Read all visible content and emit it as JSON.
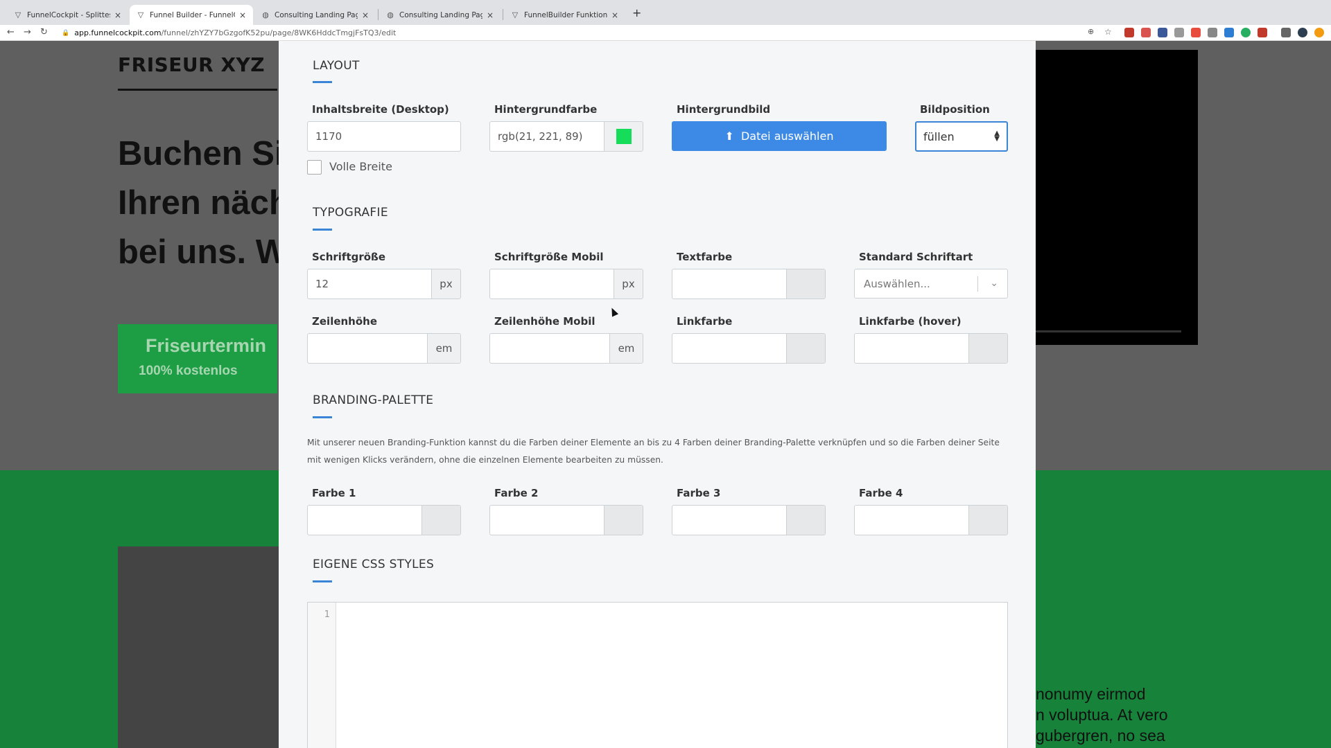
{
  "browser": {
    "tabs": [
      {
        "title": "FunnelCockpit - Splittests, Ma",
        "icon": "funnel-icon",
        "active": false
      },
      {
        "title": "Funnel Builder - FunnelCockpit",
        "icon": "funnel-icon",
        "active": true
      },
      {
        "title": "Consulting Landing Page",
        "icon": "globe-icon",
        "active": false
      },
      {
        "title": "Consulting Landing Page",
        "icon": "globe-icon",
        "active": false
      },
      {
        "title": "FunnelBuilder Funktionen & El",
        "icon": "funnel-icon",
        "active": false
      }
    ],
    "url_host": "app.funnelcockpit.com",
    "url_path": "/funnel/zhYZY7bGzgofK52pu/page/8WK6HddcTmgjFsTQ3/edit"
  },
  "background_page": {
    "brand": "FRISEUR XYZ",
    "hero_lines": [
      "Buchen Si",
      "Ihren näch",
      "bei uns. W"
    ],
    "cta_line1": "Friseurtermin",
    "cta_line2": "100% kostenlos",
    "lorem_lines": [
      "nonumy eirmod",
      "n voluptua. At vero",
      "gubergren, no sea"
    ]
  },
  "modal": {
    "layout": {
      "title": "LAYOUT",
      "content_width_label": "Inhaltsbreite (Desktop)",
      "content_width_value": "1170",
      "full_width_label": "Volle Breite",
      "bg_color_label": "Hintergrundfarbe",
      "bg_color_value": "rgb(21, 221, 89)",
      "bg_color_swatch": "#15dd59",
      "bg_image_label": "Hintergrundbild",
      "file_button_label": "Datei auswählen",
      "image_position_label": "Bildposition",
      "image_position_value": "füllen"
    },
    "typography": {
      "title": "TYPOGRAFIE",
      "font_size_label": "Schriftgröße",
      "font_size_value": "12",
      "font_size_unit": "px",
      "font_size_mobile_label": "Schriftgröße Mobil",
      "font_size_mobile_unit": "px",
      "text_color_label": "Textfarbe",
      "default_font_label": "Standard Schriftart",
      "default_font_placeholder": "Auswählen...",
      "line_height_label": "Zeilenhöhe",
      "line_height_unit": "em",
      "line_height_mobile_label": "Zeilenhöhe Mobil",
      "line_height_mobile_unit": "em",
      "link_color_label": "Linkfarbe",
      "link_color_hover_label": "Linkfarbe (hover)"
    },
    "branding": {
      "title": "BRANDING-PALETTE",
      "description": "Mit unserer neuen Branding-Funktion kannst du die Farben deiner Elemente an bis zu 4 Farben deiner Branding-Palette verknüpfen und so die Farben deiner Seite mit wenigen Klicks verändern, ohne die einzelnen Elemente bearbeiten zu müssen.",
      "color1_label": "Farbe 1",
      "color2_label": "Farbe 2",
      "color3_label": "Farbe 3",
      "color4_label": "Farbe 4"
    },
    "css": {
      "title": "EIGENE CSS STYLES",
      "line_number": "1"
    }
  },
  "colors": {
    "accent": "#3a84d8",
    "button": "#3d8ae6",
    "page_green": "#16823a"
  }
}
